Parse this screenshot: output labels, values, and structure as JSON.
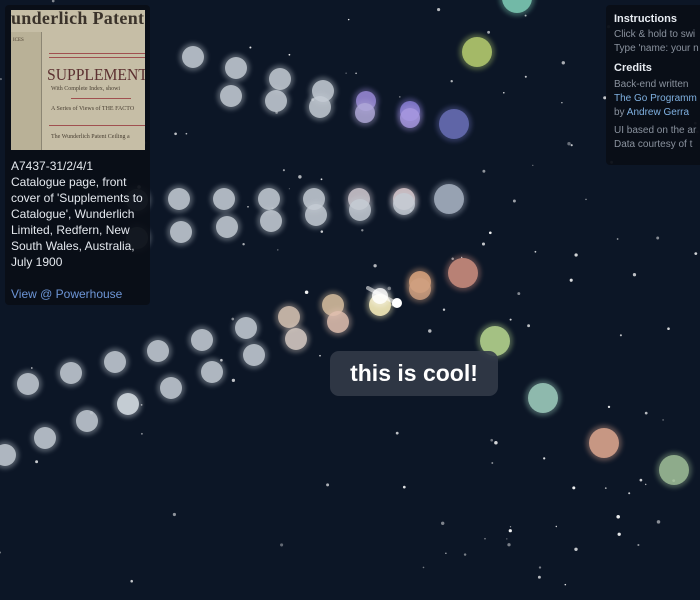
{
  "card": {
    "thumbnail": {
      "brand": "underlich Patent",
      "side_label": "ICES",
      "title": "SUPPLEMENTS TO",
      "subtitle": "With Complete Index, showi",
      "subtitle2": "A Series of Views of THE FACTO",
      "footer": "The Wunderlich Patent Ceiling a"
    },
    "caption": "A7437-31/2/4/1 Catalogue page, front cover of 'Supplements to Catalogue', Wunderlich Limited, Redfern, New South Wales, Australia, July 1900",
    "link": "View @ Powerhouse"
  },
  "panel": {
    "instructions_title": "Instructions",
    "instructions_line1": "Click & hold to swi",
    "instructions_line2": "Type 'name: your n",
    "credits_title": "Credits",
    "credits_line1": "Back-end written",
    "credits_link1": "The Go Programm",
    "credits_by": "by ",
    "credits_author": "Andrew Gerra",
    "credits_line3": "UI based on the ar",
    "credits_line4": "Data courtesy of t"
  },
  "bubble": {
    "text": "this is cool!"
  }
}
